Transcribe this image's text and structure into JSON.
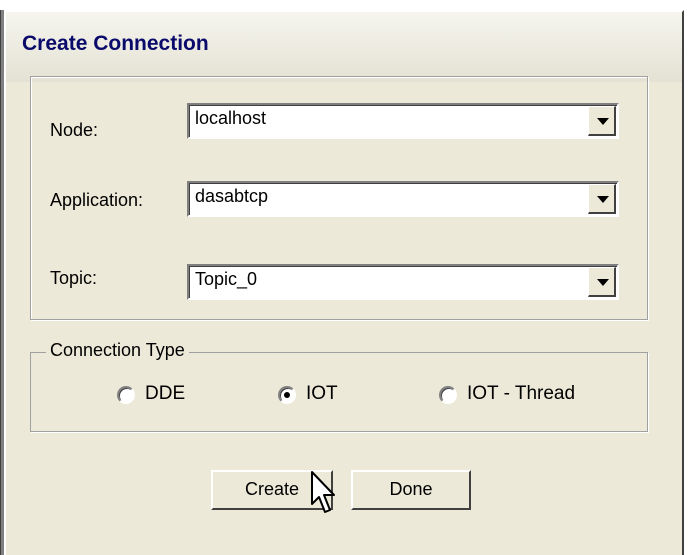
{
  "window": {
    "title": "Create Connection"
  },
  "fields": {
    "node": {
      "label": "Node:",
      "value": "localhost"
    },
    "application": {
      "label": "Application:",
      "value": "dasabtcp"
    },
    "topic": {
      "label": "Topic:",
      "value": "Topic_0"
    }
  },
  "connection_type": {
    "legend": "Connection Type",
    "options": [
      {
        "label": "DDE",
        "selected": false
      },
      {
        "label": "IOT",
        "selected": true
      },
      {
        "label": "IOT - Thread",
        "selected": false
      }
    ]
  },
  "buttons": {
    "create": "Create",
    "done": "Done"
  },
  "icons": {
    "combo_arrow": "chevron-down-icon",
    "cursor": "arrow-cursor-icon"
  }
}
